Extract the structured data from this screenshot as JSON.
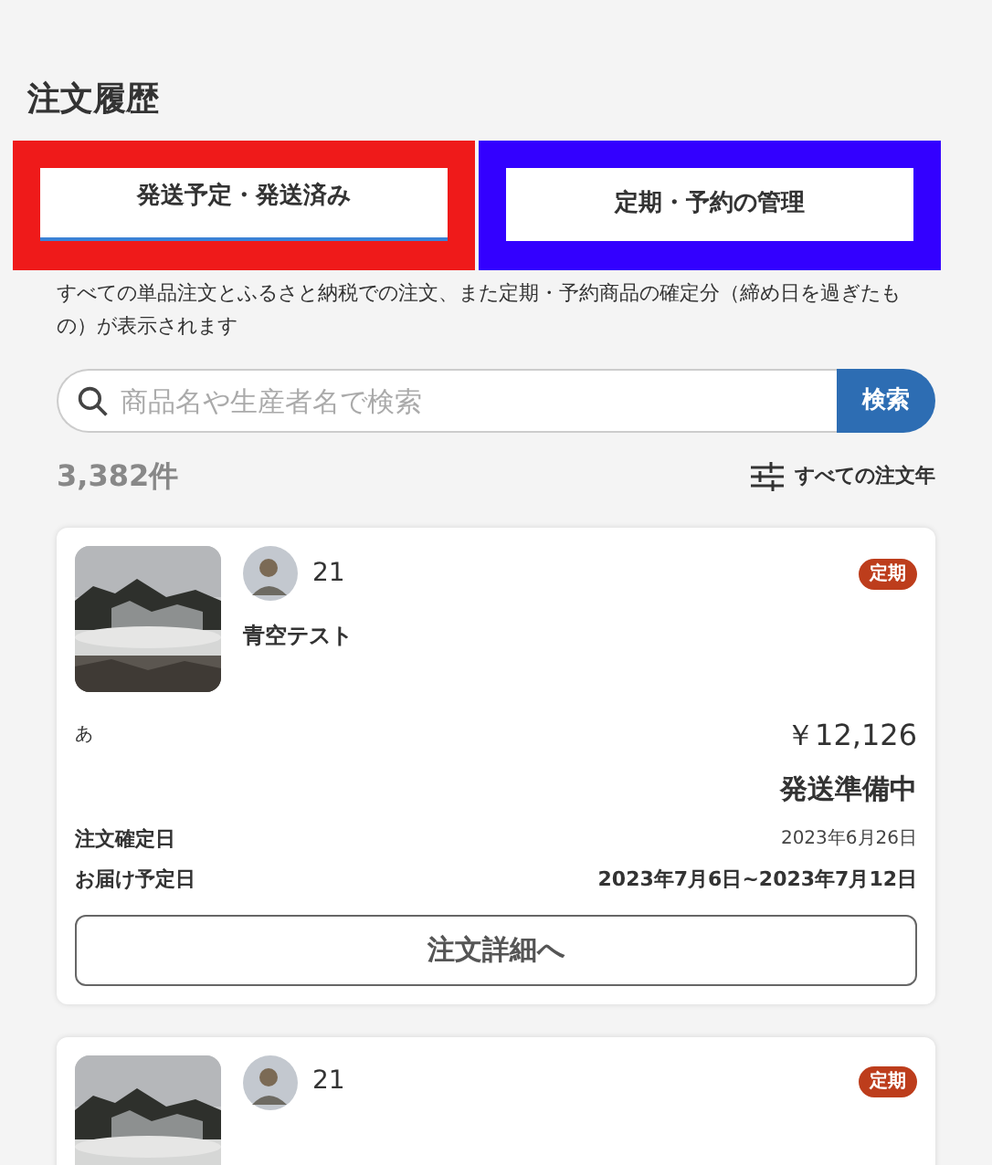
{
  "page_title": "注文履歴",
  "tabs": [
    {
      "label": "発送予定・発送済み",
      "selected": true,
      "color": "#ef1a1a"
    },
    {
      "label": "定期・予約の管理",
      "selected": false,
      "color": "#3300ff"
    }
  ],
  "description": "すべての単品注文とふるさと納税での注文、また定期・予約商品の確定分（締め日を過ぎたもの）が表示されます",
  "search": {
    "placeholder": "商品名や生産者名で検索",
    "button": "検索"
  },
  "count": "3,382件",
  "filter": "すべての注文年",
  "orders": [
    {
      "producer": "21",
      "badge": "定期",
      "product": "青空テスト",
      "note": "あ",
      "price": "￥12,126",
      "status": "発送準備中",
      "details": [
        {
          "label": "注文確定日",
          "value": "2023年6月26日",
          "bold": false
        },
        {
          "label": "お届け予定日",
          "value": "2023年7月6日~2023年7月12日",
          "bold": true
        }
      ],
      "button": "注文詳細へ"
    },
    {
      "producer": "21",
      "badge": "定期"
    }
  ]
}
